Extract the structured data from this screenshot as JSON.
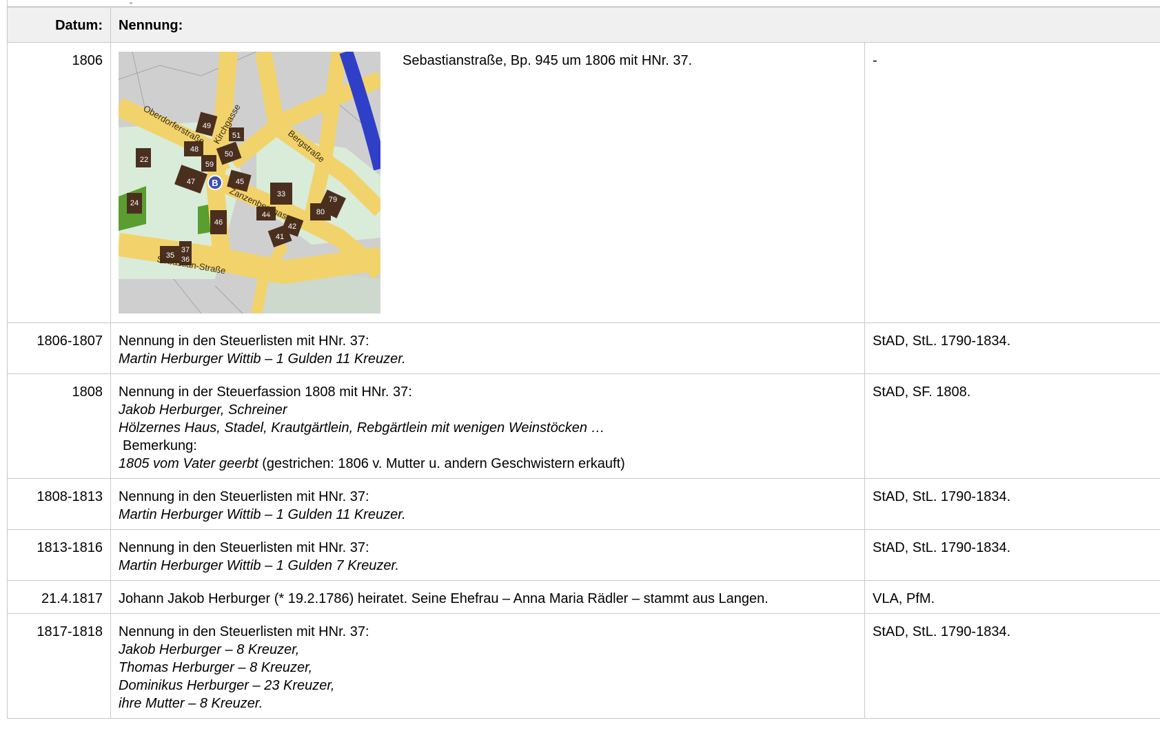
{
  "header": {
    "date_label": "Datum:",
    "entry_label": "Nennung:"
  },
  "map": {
    "labels": {
      "oberdorferstrasse": "Oberdorferstraße",
      "kirchgasse": "Kirchgasse",
      "bergstrasse": "Bergstraße",
      "zanzenberggasse": "Zanzenberggasse",
      "sebastian_strasse": "Sebastian-Straße",
      "marker": "B"
    },
    "house_numbers": [
      "49",
      "51",
      "48",
      "50",
      "22",
      "59",
      "45",
      "47",
      "33",
      "79",
      "80",
      "24",
      "44",
      "46",
      "42",
      "41",
      "35",
      "37",
      "36"
    ],
    "colors": {
      "road": "#f2d36b",
      "block": "#d9ecd9",
      "house": "#4a2f1f",
      "river": "#2f3fc8",
      "garden": "#5a9e2f",
      "marker": "#3a4fb0"
    }
  },
  "rows": [
    {
      "date": "1806",
      "text": "Sebastianstraße, Bp. 945 um 1806 mit HNr. 37.",
      "source": "-"
    },
    {
      "date": "1806-1807",
      "text": "Nennung in den Steuerlisten mit HNr. 37:",
      "detail": "Martin Herburger Wittib – 1 Gulden 11 Kreuzer.",
      "source": "StAD, StL. 1790-1834."
    },
    {
      "date": "1808",
      "text": "Nennung in der Steuerfassion 1808 mit HNr. 37:",
      "detail1": "Jakob Herburger, Schreiner",
      "detail2": "Hölzernes Haus, Stadel, Krautgärtlein, Rebgärtlein mit wenigen Weinstöcken …",
      "note_label": "Bemerkung:",
      "note_italic": "1805 vom Vater geerbt",
      "note_rest": " (gestrichen: 1806 v. Mutter u. andern Geschwistern erkauft)",
      "source": "StAD, SF. 1808."
    },
    {
      "date": "1808-1813",
      "text": "Nennung in den Steuerlisten mit HNr. 37:",
      "detail": "Martin Herburger Wittib – 1 Gulden 11 Kreuzer.",
      "source": "StAD, StL. 1790-1834."
    },
    {
      "date": "1813-1816",
      "text": "Nennung in den Steuerlisten mit HNr. 37:",
      "detail": "Martin Herburger Wittib – 1 Gulden 7 Kreuzer.",
      "source": "StAD, StL. 1790-1834."
    },
    {
      "date": "21.4.1817",
      "text": "Johann Jakob Herburger (* 19.2.1786) heiratet. Seine Ehefrau – Anna Maria Rädler – stammt aus Langen.",
      "source": "VLA, PfM."
    },
    {
      "date": "1817-1818",
      "text": "Nennung in den Steuerlisten mit HNr. 37:",
      "details": [
        "Jakob Herburger – 8 Kreuzer,",
        "Thomas Herburger – 8 Kreuzer,",
        "Dominikus Herburger – 23 Kreuzer,",
        "ihre Mutter – 8 Kreuzer."
      ],
      "source": "StAD, StL. 1790-1834."
    }
  ]
}
